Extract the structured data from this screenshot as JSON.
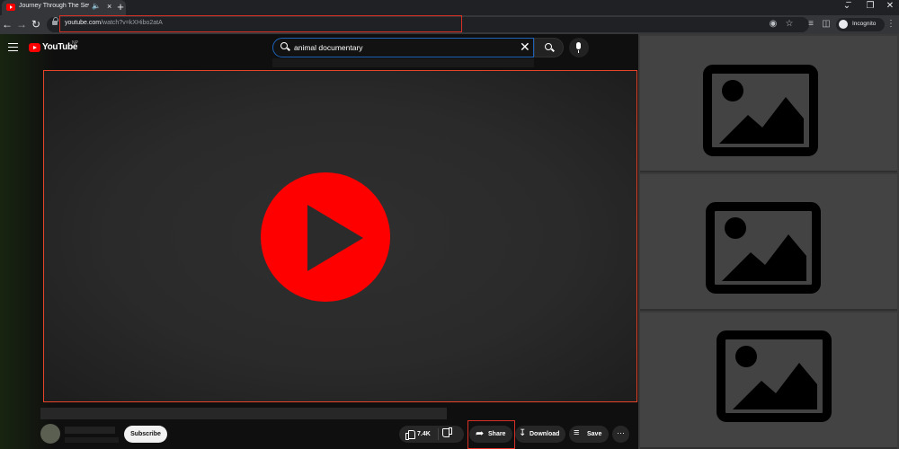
{
  "browser": {
    "tab": {
      "title": "Journey Through The Seven"
    },
    "url": {
      "domain": "youtube.com",
      "path": "/watch?v=kXHibo2atA"
    },
    "profile_label": "Incognito"
  },
  "youtube": {
    "brand": "YouTube",
    "country_code": "NP",
    "search": {
      "query": "animal documentary"
    },
    "actions": {
      "subscribe": "Subscribe",
      "like_count": "7.4K",
      "share": "Share",
      "download": "Download",
      "save": "Save",
      "more": "···"
    }
  },
  "colors": {
    "highlight": "#d93025",
    "play_button": "#ff0000",
    "search_focus": "#1c62b9"
  }
}
